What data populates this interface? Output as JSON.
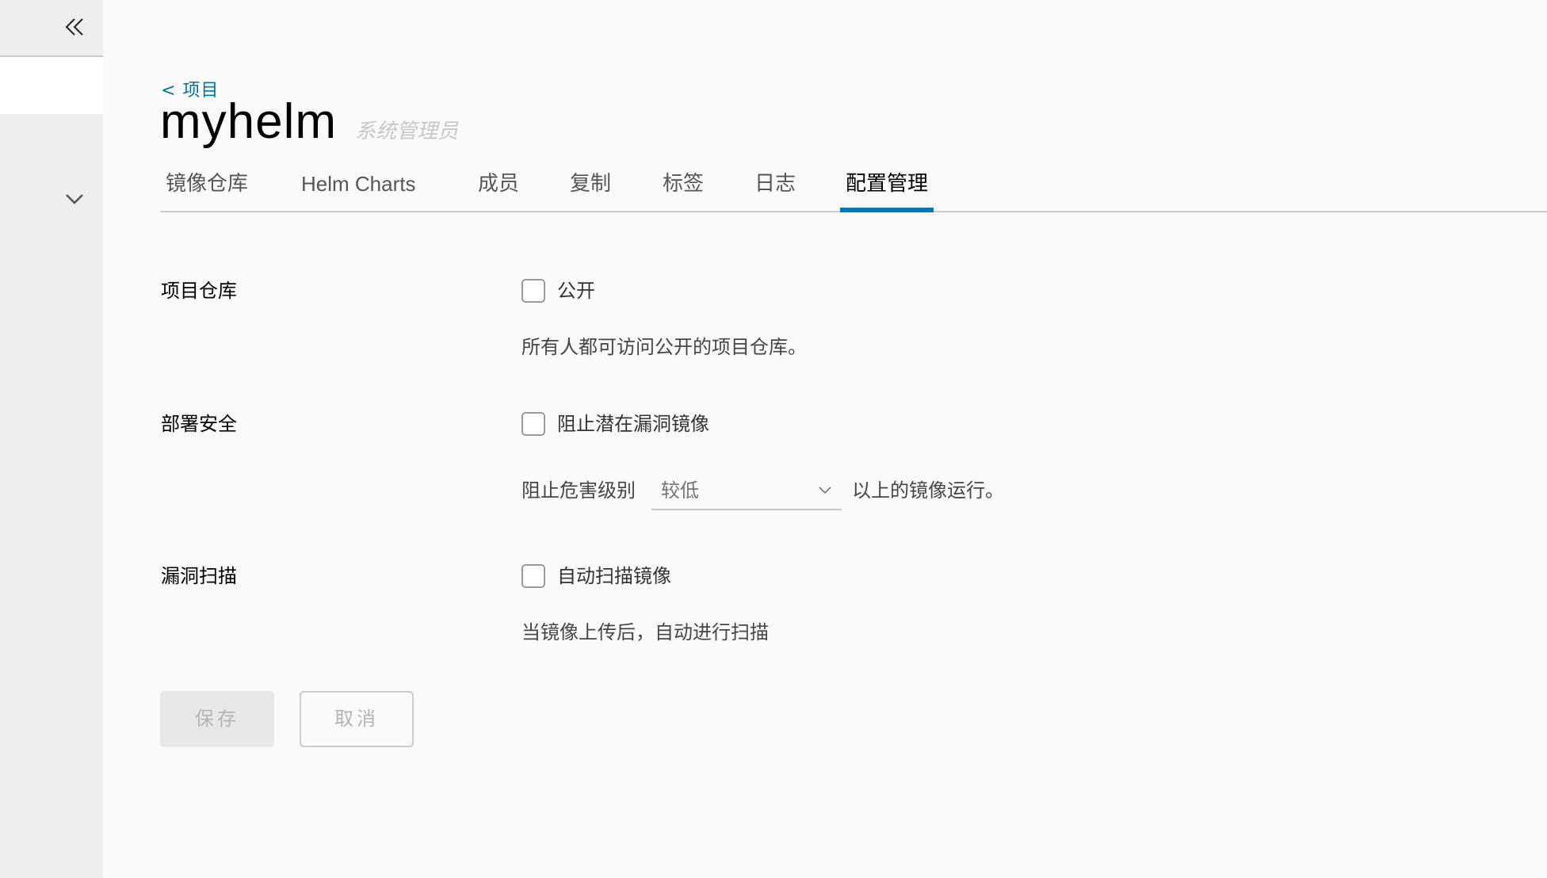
{
  "sidebar": {
    "collapse_icon": "double-chevron-left-icon",
    "expand_icon": "chevron-down-icon"
  },
  "header": {
    "back_link": "< 项目",
    "project_name": "myhelm",
    "role": "系统管理员"
  },
  "tabs": [
    {
      "label": "镜像仓库",
      "active": false
    },
    {
      "label": "Helm Charts",
      "active": false
    },
    {
      "label": "成员",
      "active": false
    },
    {
      "label": "复制",
      "active": false
    },
    {
      "label": "标签",
      "active": false
    },
    {
      "label": "日志",
      "active": false
    },
    {
      "label": "配置管理",
      "active": true
    }
  ],
  "colors": {
    "accent": "#0079b8",
    "link": "#0072a3",
    "sidebar_bg": "#eeeeee",
    "page_bg": "#fafafa"
  },
  "config": {
    "project_registry": {
      "label": "项目仓库",
      "checkbox_label": "公开",
      "checked": false,
      "description": "所有人都可访问公开的项目仓库。"
    },
    "deployment_security": {
      "label": "部署安全",
      "checkbox_label": "阻止潜在漏洞镜像",
      "checked": false,
      "severity_prefix": "阻止危害级别",
      "severity_value": "较低",
      "severity_suffix": "以上的镜像运行。"
    },
    "vulnerability_scan": {
      "label": "漏洞扫描",
      "checkbox_label": "自动扫描镜像",
      "checked": false,
      "description": "当镜像上传后，自动进行扫描"
    }
  },
  "actions": {
    "save_label": "保存",
    "cancel_label": "取消",
    "save_disabled": true
  }
}
